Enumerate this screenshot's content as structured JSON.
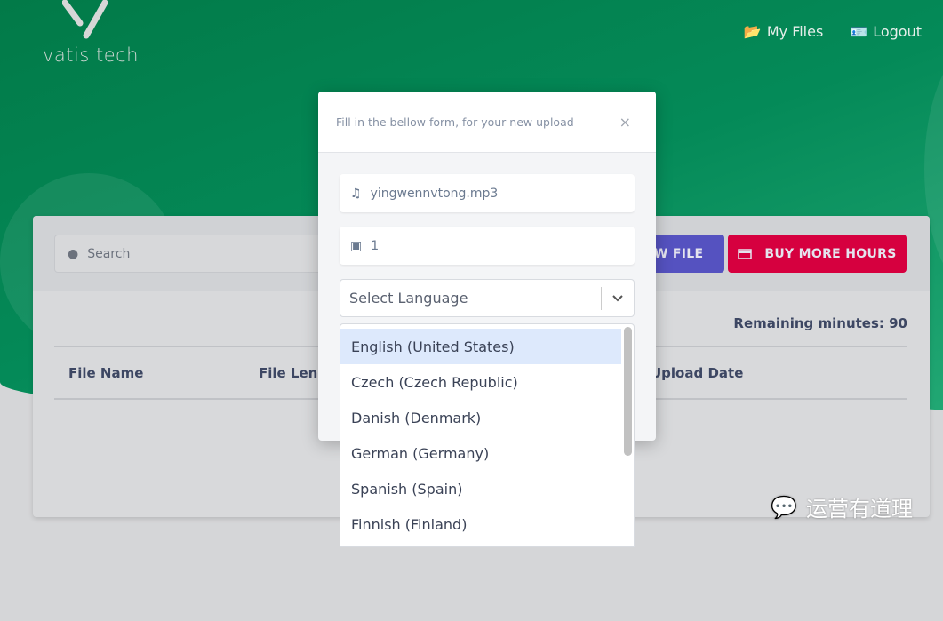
{
  "brand": {
    "name": "vatis tech"
  },
  "nav": {
    "items": [
      {
        "label": "My Files",
        "icon": "folder-open-icon"
      },
      {
        "label": "Logout",
        "icon": "id-card-icon"
      }
    ]
  },
  "toolbar": {
    "search_placeholder": "Search",
    "new_file_label": "IEW FILE",
    "buy_label": "BUY MORE HOURS"
  },
  "main": {
    "remaining": "Remaining minutes: 90",
    "columns": [
      "File Name",
      "File Leng",
      "Upload Date"
    ]
  },
  "modal": {
    "title": "Fill in the bellow form, for your new upload",
    "close": "×",
    "file_name": "yingwennvtong.mp3",
    "speakers": "1",
    "language_placeholder": "Select Language",
    "options": [
      "English (United States)",
      "Czech (Czech Republic)",
      "Danish (Denmark)",
      "German (Germany)",
      "Spanish (Spain)",
      "Finnish (Finland)"
    ],
    "selected_index": 0
  },
  "watermark": {
    "text": "运营有道理"
  },
  "colors": {
    "green": "#048a58",
    "buy": "#d6003f",
    "new": "#5552c0",
    "highlight": "#dde9fc"
  }
}
